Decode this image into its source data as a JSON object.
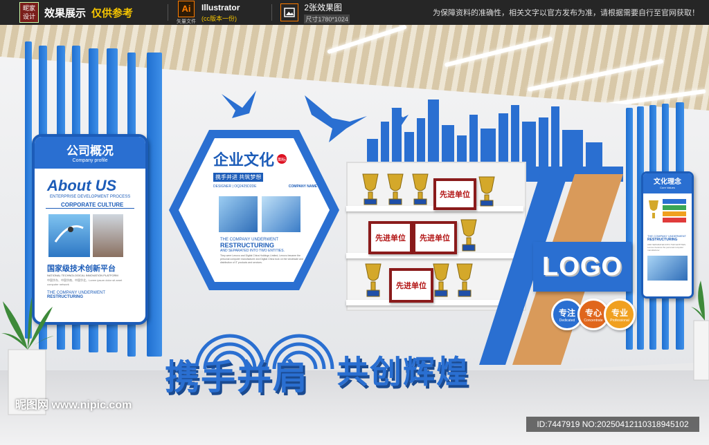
{
  "topbar": {
    "logo_line1": "昵家",
    "logo_line2": "设计",
    "title": "效果展示",
    "accent": "仅供参考",
    "ai_label": "Ai",
    "ai_sub": "矢量文件",
    "app_name": "Illustrator",
    "app_version": "(cc版本一份)",
    "image_title": "2张效果图",
    "image_size": "尺寸1780*1024",
    "note": "为保障资料的准确性，相关文字以官方发布为准，请根据需要自行至官网获取！"
  },
  "left_panel": {
    "heading": "公司概况",
    "heading_en": "Company profile",
    "about": "About US",
    "about_sub": "ENTERPRISE DEVELOPMENT PROCESS",
    "culture": "CORPORATE CULTURE",
    "platform": "国家级技术创新平台",
    "platform_en": "NATIONAL TECHNOLOGICAL INNOVATION PLATFORM",
    "body_text": "中国华东、中国华南、中国华北，Lorem ipsum dolor sit amet computer network",
    "footer1": "THE COMPANY UNDERWENT",
    "footer2": "RESTRUCTURING"
  },
  "hex_panel": {
    "title": "企业文化",
    "badge": "图标",
    "slogan": "携手并进 共筑梦想",
    "designer": "DESIGNER | OQ2425D2DE",
    "company_name": "COMPANY NAME",
    "line1": "THE COMPANY UNDERWENT",
    "line2": "RESTRUCTURING",
    "line3": "AND SEPARATED INTO TWO ENTITIES.",
    "small": "They were Lenovo and Digital China Holdings Limited, Lenovo became the personal computer manufacturer and Digital China took on the wholesale and distribution of IT products and services."
  },
  "shelf": {
    "plaques": [
      "先进单位",
      "先进单位",
      "先进单位",
      "先进单位"
    ]
  },
  "logo_block": {
    "logo": "LOGO",
    "badges": [
      {
        "zh": "专注",
        "en": "Dedicated",
        "color": "#2a6fd1"
      },
      {
        "zh": "专心",
        "en": "Concentrate",
        "color": "#e0661c"
      },
      {
        "zh": "专业",
        "en": "Professional",
        "color": "#f0a020"
      }
    ]
  },
  "right_panel": {
    "heading": "文化理念",
    "heading_en": "Core Values",
    "line1": "THE COMPANY UNDERWENT",
    "line2": "RESTRUCTURING",
    "small": "AND SEPARATED INTO TWO ENTITIES. Lenovo became the personal computer manufacturer"
  },
  "floor_slogan": {
    "part1": "携手并肩",
    "part2": "共创辉煌"
  },
  "watermark": {
    "site": "昵图网 www.nipic.com",
    "id": "ID:7447919 NO:20250412110318945102"
  }
}
